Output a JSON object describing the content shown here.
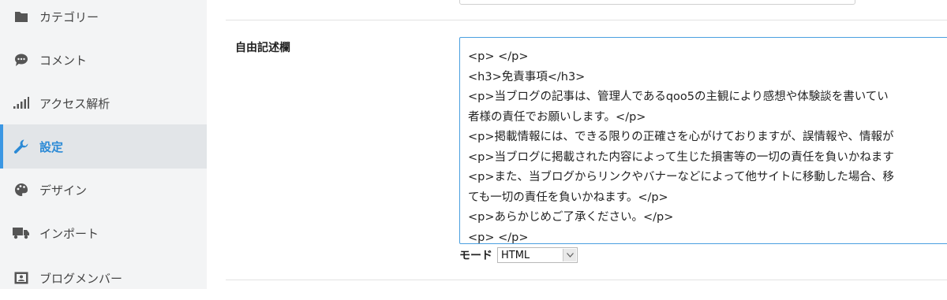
{
  "sidebar": {
    "items": [
      {
        "label": "カテゴリー",
        "icon": "folder-icon"
      },
      {
        "label": "コメント",
        "icon": "comment-icon"
      },
      {
        "label": "アクセス解析",
        "icon": "signal-bars-icon"
      },
      {
        "label": "設定",
        "icon": "wrench-icon",
        "active": true
      },
      {
        "label": "デザイン",
        "icon": "palette-icon"
      },
      {
        "label": "インポート",
        "icon": "truck-icon"
      },
      {
        "label": "ブログメンバー",
        "icon": "member-card-icon"
      }
    ]
  },
  "main": {
    "field_label": "自由記述欄",
    "textarea_lines": [
      "<p> </p>",
      "<h3>免責事項</h3>",
      "<p>当ブログの記事は、管理人であるqoo5の主観により感想や体験談を書いてい",
      "者様の責任でお願いします。</p>",
      "<p>掲載情報には、できる限りの正確さを心がけておりますが、誤情報や、情報が",
      "<p>当ブログに掲載された内容によって生じた損害等の一切の責任を負いかねます",
      "<p>また、当ブログからリンクやバナーなどによって他サイトに移動した場合、移",
      "ても一切の責任を負いかねます。</p>",
      "<p>あらかじめご了承ください。</p>",
      "<p> </p>"
    ],
    "mode": {
      "label": "モード",
      "value": "HTML"
    }
  },
  "colors": {
    "accent": "#3b97e3",
    "sidebar_bg": "#f3f4f5",
    "active_bg": "#e2e5e8"
  }
}
